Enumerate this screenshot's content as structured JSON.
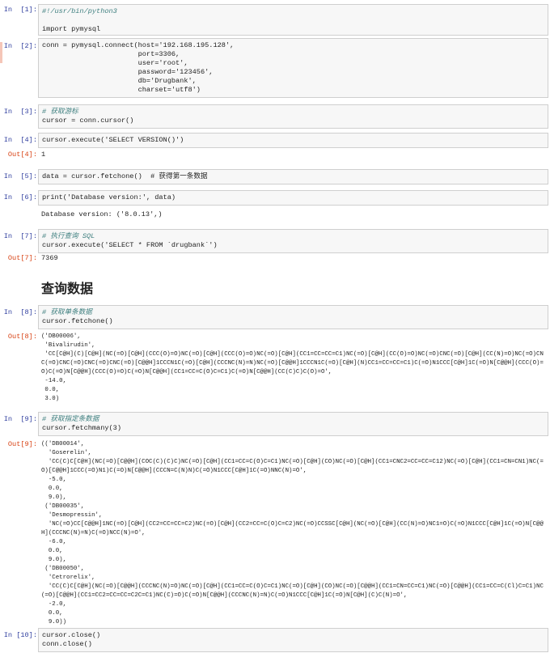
{
  "cells": [
    {
      "prompt": "In  [1]:",
      "lines": [
        "#!/usr/bin/python3",
        "",
        "import pymysql"
      ]
    },
    {
      "prompt": "In  [2]:",
      "lines": [
        "conn = pymysql.connect(host='192.168.195.128',",
        "                       port=3306,",
        "                       user='root',",
        "                       password='123456',",
        "                       db='Drugbank',",
        "                       charset='utf8')"
      ]
    },
    {
      "prompt": "In  [3]:",
      "lines": [
        "# 获取游标",
        "cursor = conn.cursor()"
      ]
    },
    {
      "prompt": "In  [4]:",
      "lines": [
        "cursor.execute('SELECT VERSION()')"
      ],
      "out_prompt": "Out[4]:",
      "output": "1"
    },
    {
      "prompt": "In  [5]:",
      "lines": [
        "data = cursor.fetchone()  # 获得第一条数据"
      ]
    },
    {
      "prompt": "In  [6]:",
      "lines": [
        "print('Database version:', data)"
      ],
      "output": "Database version: ('8.0.13',)"
    },
    {
      "prompt": "In  [7]:",
      "lines": [
        "# 执行查询 SQL",
        "cursor.execute('SELECT * FROM `drugbank`')"
      ],
      "out_prompt": "Out[7]:",
      "output": "7369"
    },
    {
      "heading": "查询数据"
    },
    {
      "prompt": "In  [8]:",
      "lines": [
        "# 获取单条数据",
        "cursor.fetchone()"
      ],
      "out_prompt": "Out[8]:",
      "output": "('DB00006',\n 'Bivalirudin',\n 'CC[C@H](C)[C@H](NC(=O)[C@H](CCC(O)=O)NC(=O)[C@H](CCC(O)=O)NC(=O)[C@H](CC1=CC=CC=C1)NC(=O)[C@H](CC(O)=O)NC(=O)CNC(=O)[C@H](CC(N)=O)NC(=O)CN\nC(=O)CNC(=O)CNC(=O)CNC(=O)[C@@H]1CCCN1C(=O)[C@H](CCCNC(N)=N)NC(=O)[C@@H]1CCCN1C(=O)[C@H](N)CC1=CC=CC=C1)C(=O)N1CCC[C@H]1C(=O)N[C@@H](CCC(O)=\nO)C(=O)N[C@@H](CCC(O)=O)C(=O)N[C@@H](CC1=CC=C(O)C=C1)C(=O)N[C@@H](CC(C)C)C(O)=O',\n -14.0,\n 0.0,\n 3.0)"
    },
    {
      "prompt": "In  [9]:",
      "lines": [
        "# 获取指定条数据",
        "cursor.fetchmany(3)"
      ],
      "out_prompt": "Out[9]:",
      "output": "(('DB00014',\n  'Goserelin',\n  'CC(C)C[C@H](NC(=O)[C@@H](COC(C)(C)C)NC(=O)[C@H](CC1=CC=C(O)C=C1)NC(=O)[C@H](CO)NC(=O)[C@H](CC1=CNC2=CC=CC=C12)NC(=O)[C@H](CC1=CN=CN1)NC(=\nO)[C@@H]1CCC(=O)N1)C(=O)N[C@@H](CCCN=C(N)N)C(=O)N1CCC[C@H]1C(=O)NNC(N)=O',\n  -5.0,\n  0.0,\n  9.0),\n ('DB00035',\n  'Desmopressin',\n  'NC(=O)CC[C@@H]1NC(=O)[C@H](CC2=CC=CC=C2)NC(=O)[C@H](CC2=CC=C(O)C=C2)NC(=O)CCSSC[C@H](NC(=O)[C@H](CC(N)=O)NC1=O)C(=O)N1CCC[C@H]1C(=O)N[C@@\nH](CCCNC(N)=N)C(=O)NCC(N)=O',\n  -6.0,\n  0.0,\n  9.0),\n ('DB00050',\n  'Cetrorelix',\n  'CC(C)C[C@H](NC(=O)[C@@H](CCCNC(N)=O)NC(=O)[C@H](CC1=CC=C(O)C=C1)NC(=O)[C@H](CO)NC(=O)[C@@H](CC1=CN=CC=C1)NC(=O)[C@@H](CC1=CC=C(Cl)C=C1)NC\n(=O)[C@@H](CC1=CC2=CC=CC=C2C=C1)NC(C)=O)C(=O)N[C@@H](CCCNC(N)=N)C(=O)N1CCC[C@H]1C(=O)N[C@H](C)C(N)=O',\n  -2.0,\n  0.0,\n  9.0))"
    },
    {
      "prompt": "In [10]:",
      "lines": [
        "cursor.close()",
        "conn.close()"
      ]
    }
  ]
}
